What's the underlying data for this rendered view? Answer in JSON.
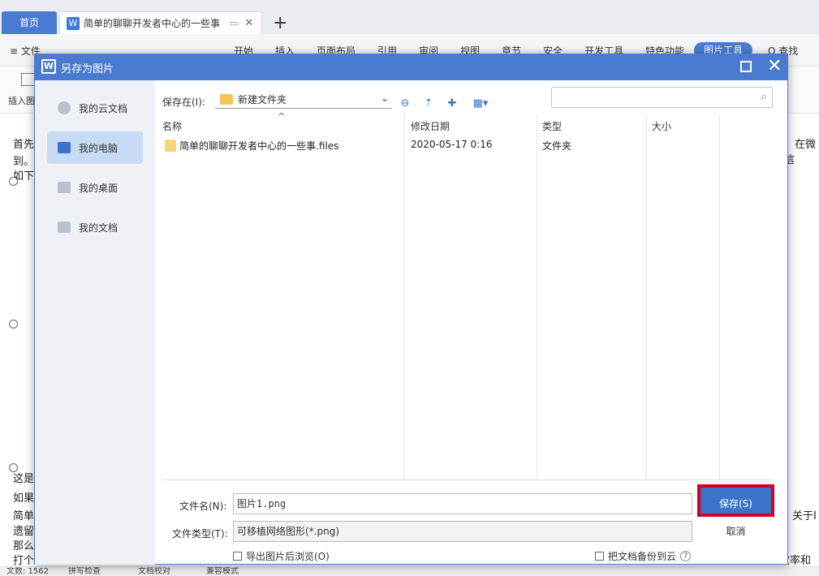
{
  "app": {
    "tabs": {
      "home": "首页",
      "doc_title": "简单的聊聊开发者中心的一些事"
    },
    "menu": {
      "file": "≡ 文件",
      "items": [
        "开始",
        "插入",
        "页面布局",
        "引用",
        "审阅",
        "视图",
        "章节",
        "安全",
        "开发工具",
        "特色功能"
      ],
      "picture_tools": "图片工具",
      "search": "Q 查找"
    },
    "ribbon": {
      "insert_picture": "插入图"
    },
    "document_lines": {
      "l1": "首先",
      "l1_right": "，在微信",
      "l2": "到。",
      "l3": "如下",
      "l4": "这是",
      "l5": "如果",
      "l6": "简单",
      "l6_right": "关于I",
      "l7": "遗留",
      "l8": "那么",
      "l9": "打个",
      "l9_right": "效率和"
    },
    "status": {
      "word_count": "文数: 1562",
      "spellcheck": "拼写检查",
      "doc_check": "文档校对",
      "compat": "兼容模式"
    }
  },
  "dialog": {
    "title": "另存为图片",
    "sidebar": [
      {
        "label": "我的云文档",
        "icon": "cloud-cube-icon"
      },
      {
        "label": "我的电脑",
        "icon": "computer-icon",
        "active": true
      },
      {
        "label": "我的桌面",
        "icon": "desktop-icon"
      },
      {
        "label": "我的文档",
        "icon": "folder-icon"
      }
    ],
    "save_in_label": "保存在(I):",
    "save_in_value": "新建文件夹",
    "columns": {
      "name": "名称",
      "modified": "修改日期",
      "type": "类型",
      "size": "大小"
    },
    "rows": [
      {
        "name": "简单的聊聊开发者中心的一些事.files",
        "modified": "2020-05-17 0:16",
        "type": "文件夹",
        "size": ""
      }
    ],
    "filename_label": "文件名(N):",
    "filename_value": "图片1.png",
    "filetype_label": "文件类型(T):",
    "filetype_value": "可移植网络图形(*.png)",
    "save_button": "保存(S)",
    "cancel_button": "取消",
    "checkbox_browse": "导出图片后浏览(O)",
    "checkbox_backup": "把文档备份到云",
    "help": "?"
  }
}
